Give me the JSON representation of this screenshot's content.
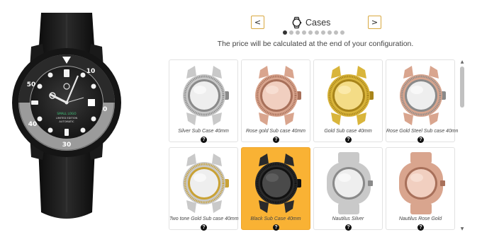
{
  "step": {
    "title": "Cases",
    "icon": "watch-case-icon",
    "prev_label": "<",
    "next_label": ">",
    "total_steps": 10,
    "current_step": 1
  },
  "price_note": "The price will be calculated at the end of your configuration.",
  "cases": [
    {
      "name": "Silver Sub Case 40mm",
      "finish": "silver",
      "style": "sub",
      "selected": false
    },
    {
      "name": "Rose gold Sub case 40mm",
      "finish": "rose",
      "style": "sub",
      "selected": false
    },
    {
      "name": "Gold Sub case 40mm",
      "finish": "gold",
      "style": "sub",
      "selected": false
    },
    {
      "name": "Rose Gold Steel Sub case 40mm",
      "finish": "rose-steel",
      "style": "sub",
      "selected": false
    },
    {
      "name": "Two tone Gold Sub case 40mm",
      "finish": "two-tone",
      "style": "sub",
      "selected": false
    },
    {
      "name": "Black Sub Case 40mm",
      "finish": "black",
      "style": "sub",
      "selected": true
    },
    {
      "name": "Nautilus Silver",
      "finish": "silver",
      "style": "nautilus",
      "selected": false
    },
    {
      "name": "Nautilus Rose Gold",
      "finish": "rose",
      "style": "nautilus",
      "selected": false
    }
  ],
  "info_label": "?",
  "preview": {
    "dial_logo_text": "SMALL LOGO",
    "dial_line1": "LIMITED EDITION",
    "dial_line2": "AUTOMATIC",
    "bezel_numbers": [
      "10",
      "20",
      "30",
      "40",
      "50"
    ]
  },
  "colors": {
    "accent": "#f9b234",
    "nav_border": "#d8a840",
    "lume_green": "#3ec47a"
  }
}
